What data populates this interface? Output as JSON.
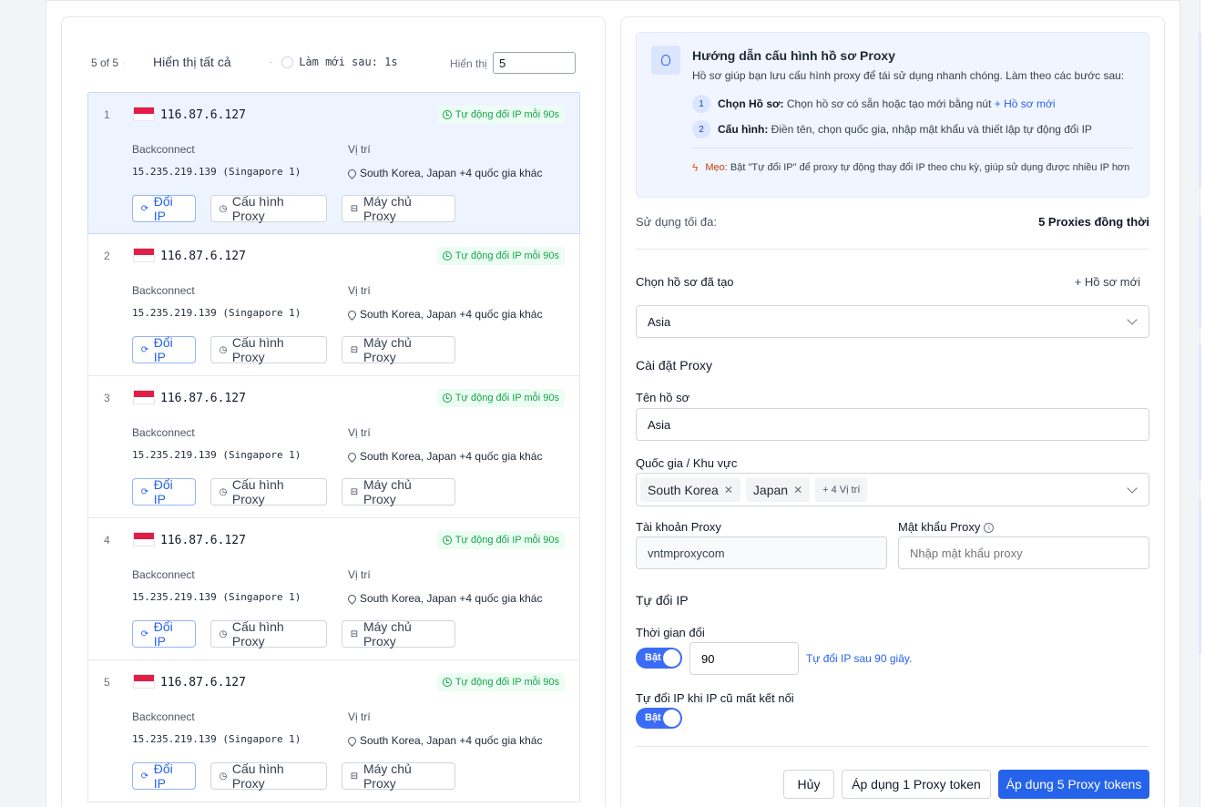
{
  "toolbar": {
    "count": "5 of 5",
    "show_all": "Hiển thị tất cả",
    "refresh": "Làm mới sau: 1s",
    "show_label": "Hiển thị",
    "show_value": "5"
  },
  "proxies": [
    {
      "num": "1",
      "ip": "116.87.6.127",
      "badge": "Tự động đổi IP mỗi 90s",
      "backconnect_label": "Backconnect",
      "backconnect": "15.235.219.139 (Singapore 1)",
      "location_label": "Vị trí",
      "location": "South Korea, Japan +4 quốc gia khác",
      "btn_change": "Đổi IP",
      "btn_config": "Cấu hình Proxy",
      "btn_server": "Máy chủ Proxy"
    },
    {
      "num": "2",
      "ip": "116.87.6.127",
      "badge": "Tự động đổi IP mỗi 90s",
      "backconnect_label": "Backconnect",
      "backconnect": "15.235.219.139 (Singapore 1)",
      "location_label": "Vị trí",
      "location": "South Korea, Japan +4 quốc gia khác",
      "btn_change": "Đổi IP",
      "btn_config": "Cấu hình Proxy",
      "btn_server": "Máy chủ Proxy"
    },
    {
      "num": "3",
      "ip": "116.87.6.127",
      "badge": "Tự động đổi IP mỗi 90s",
      "backconnect_label": "Backconnect",
      "backconnect": "15.235.219.139 (Singapore 1)",
      "location_label": "Vị trí",
      "location": "South Korea, Japan +4 quốc gia khác",
      "btn_change": "Đổi IP",
      "btn_config": "Cấu hình Proxy",
      "btn_server": "Máy chủ Proxy"
    },
    {
      "num": "4",
      "ip": "116.87.6.127",
      "badge": "Tự động đổi IP mỗi 90s",
      "backconnect_label": "Backconnect",
      "backconnect": "15.235.219.139 (Singapore 1)",
      "location_label": "Vị trí",
      "location": "South Korea, Japan +4 quốc gia khác",
      "btn_change": "Đổi IP",
      "btn_config": "Cấu hình Proxy",
      "btn_server": "Máy chủ Proxy"
    },
    {
      "num": "5",
      "ip": "116.87.6.127",
      "badge": "Tự động đổi IP mỗi 90s",
      "backconnect_label": "Backconnect",
      "backconnect": "15.235.219.139 (Singapore 1)",
      "location_label": "Vị trí",
      "location": "South Korea, Japan +4 quốc gia khác",
      "btn_change": "Đổi IP",
      "btn_config": "Cấu hình Proxy",
      "btn_server": "Máy chủ Proxy"
    }
  ],
  "guide": {
    "title": "Hướng dẫn cấu hình hồ sơ Proxy",
    "desc": "Hồ sơ giúp bạn lưu cấu hình proxy để tái sử dụng nhanh chóng. Làm theo các bước sau:",
    "step1_num": "1",
    "step1_bold": "Chọn Hồ sơ:",
    "step1_text": "Chọn hồ sơ có sẵn hoặc tạo mới bằng nút",
    "step1_link": "+ Hồ sơ mới",
    "step2_num": "2",
    "step2_bold": "Cấu hình:",
    "step2_text": "Điền tên, chọn quốc gia, nhập mật khẩu và thiết lập tự động đổi IP",
    "tip_label": "Mẹo:",
    "tip_text": "Bật \"Tự đổi IP\" để proxy tự động thay đổi IP theo chu kỳ, giúp sử dụng được nhiều IP hơn"
  },
  "usage": {
    "label": "Sử dụng tối đa:",
    "value": "5 Proxies đồng thời"
  },
  "profile": {
    "label": "Chọn hồ sơ đã tạo",
    "new_btn": "+ Hồ sơ mới",
    "selected": "Asia"
  },
  "settings": {
    "title": "Cài đặt Proxy",
    "name_label": "Tên hồ sơ",
    "name_value": "Asia",
    "country_label": "Quốc gia / Khu vực",
    "tags": [
      "South Korea",
      "Japan"
    ],
    "more_tag": "+ 4 Vị trí",
    "account_label": "Tài khoản Proxy",
    "account_value": "vntmproxycom",
    "password_label": "Mật khẩu Proxy",
    "password_placeholder": "Nhập mật khẩu proxy"
  },
  "auto": {
    "title": "Tự đổi IP",
    "interval_label": "Thời gian đổi",
    "toggle1": "Bật",
    "interval_value": "90",
    "hint": "Tự đổi IP sau 90 giây.",
    "disconnect_label": "Tự đổi IP khi IP cũ mất kết nối",
    "toggle2": "Bật"
  },
  "footer": {
    "cancel": "Hủy",
    "apply_one": "Áp dụng 1 Proxy token",
    "apply_five": "Áp dụng 5 Proxy tokens"
  }
}
